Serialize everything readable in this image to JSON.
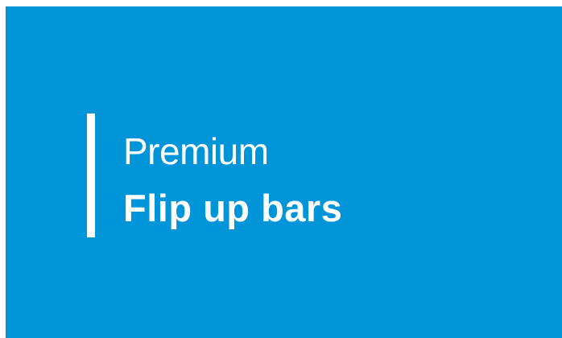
{
  "banner": {
    "subtitle": "Premium",
    "title": "Flip up bars"
  },
  "colors": {
    "background": "#0094d8",
    "text": "#ffffff",
    "accent_bar": "#ffffff"
  }
}
